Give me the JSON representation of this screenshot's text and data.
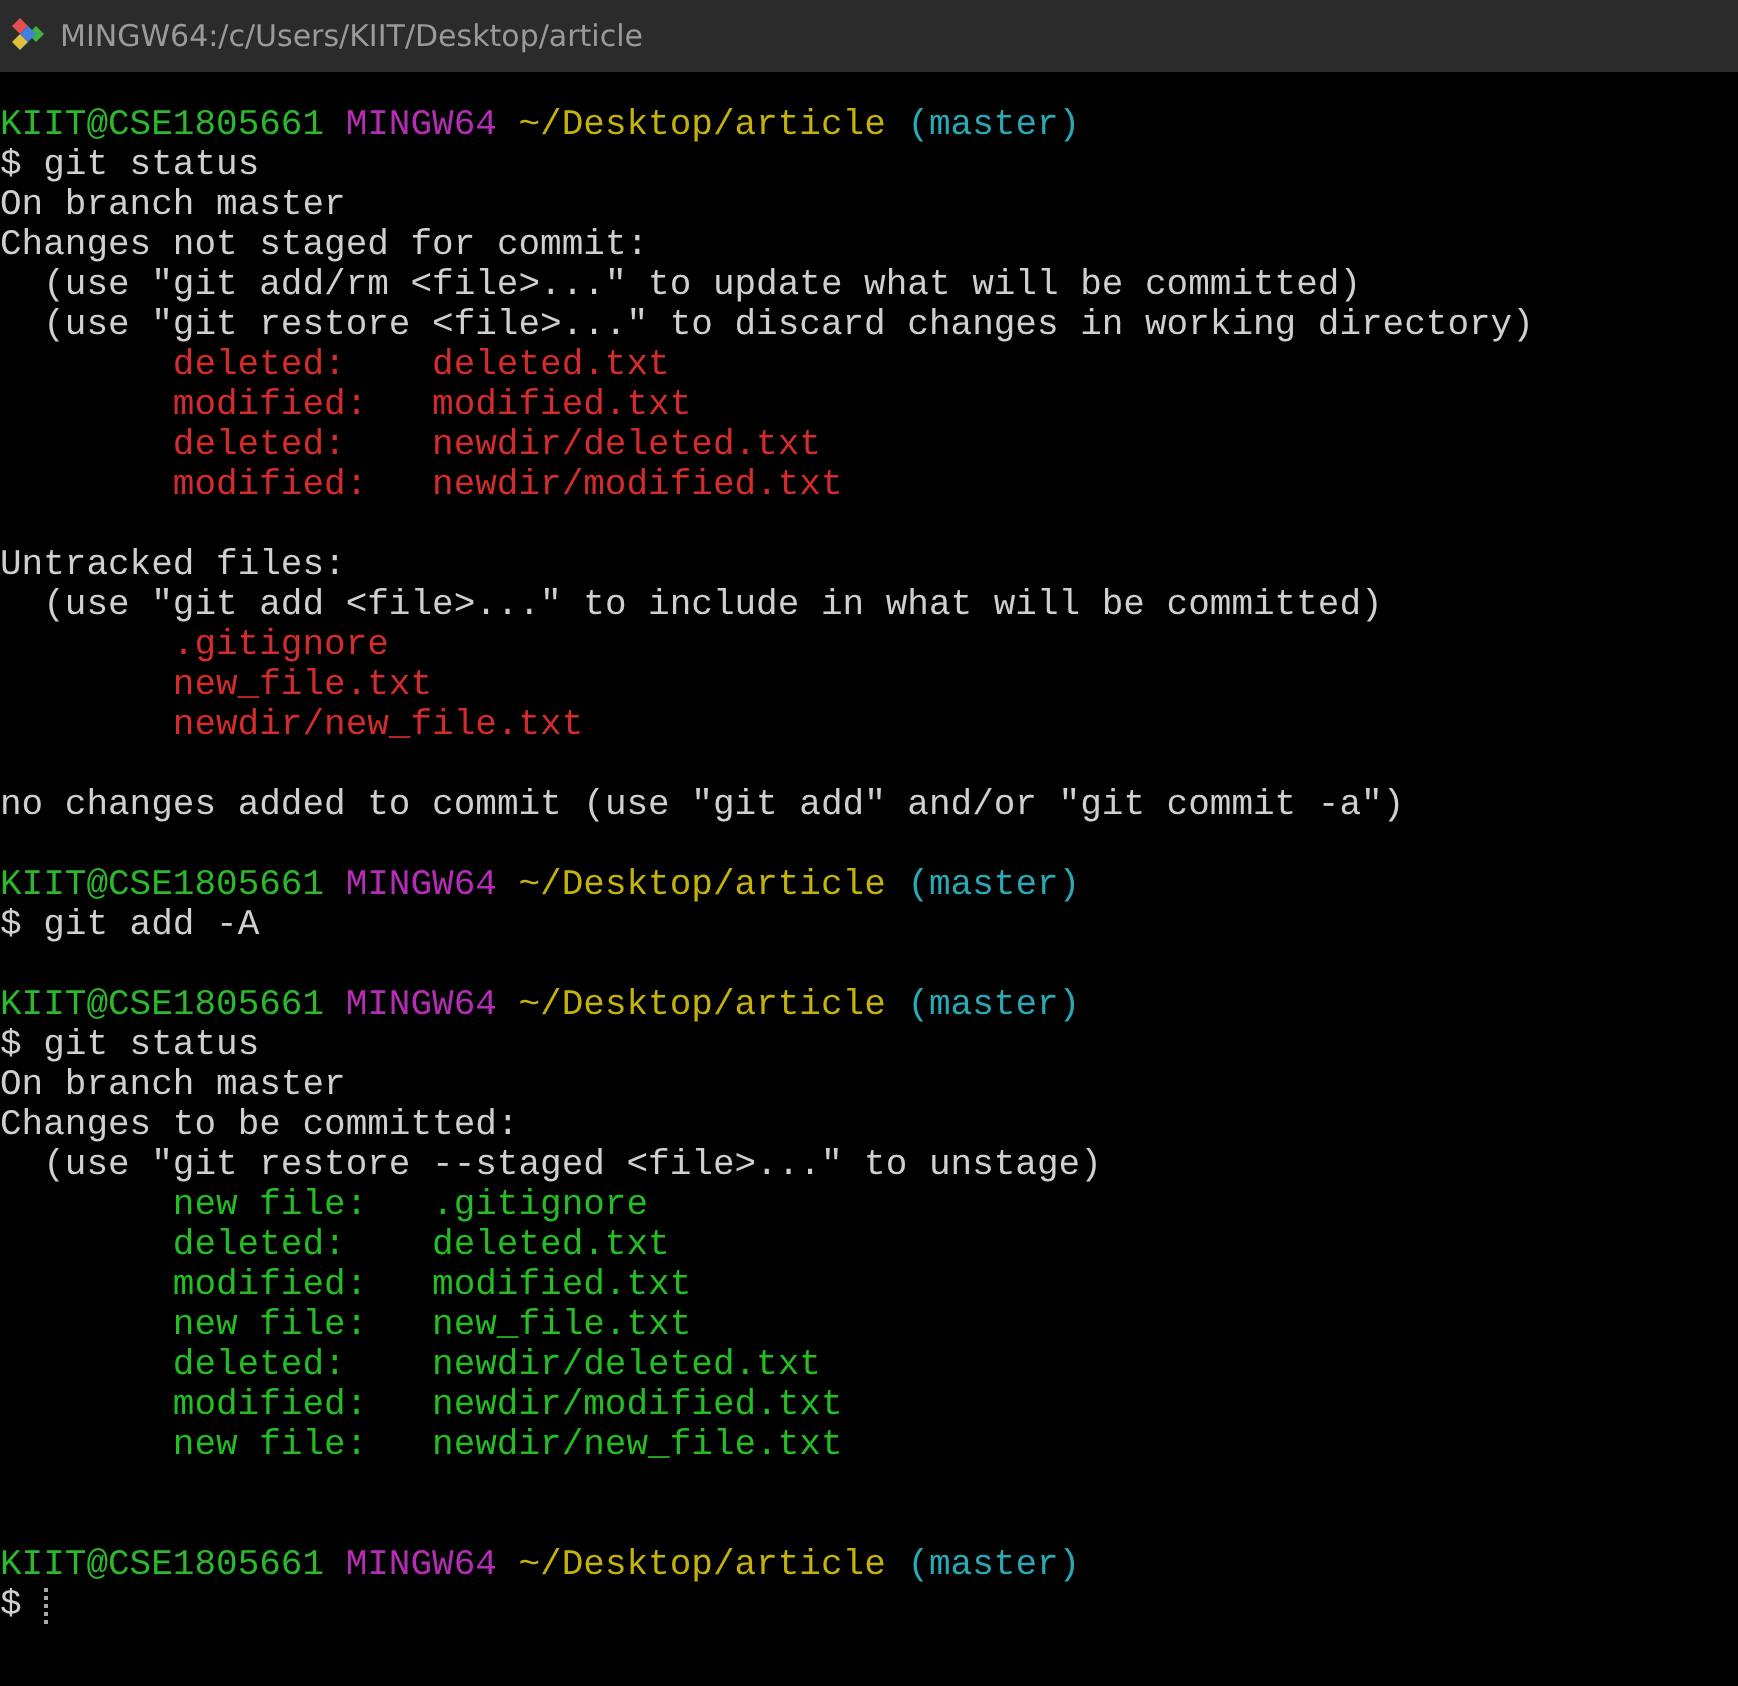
{
  "window": {
    "title": "MINGW64:/c/Users/KIIT/Desktop/article"
  },
  "lines": [
    {
      "kind": "prompt",
      "user": "KIIT@CSE1805661",
      "system": "MINGW64",
      "path": "~/Desktop/article",
      "branch": "(master)"
    },
    {
      "kind": "text",
      "text": "$ git status"
    },
    {
      "kind": "text",
      "text": "On branch master"
    },
    {
      "kind": "text",
      "text": "Changes not staged for commit:"
    },
    {
      "kind": "hint",
      "text": "(use \"git add/rm <file>...\" to update what will be committed)"
    },
    {
      "kind": "hint",
      "text": "(use \"git restore <file>...\" to discard changes in working directory)"
    },
    {
      "kind": "entry",
      "color": "#d42c2c",
      "status": "deleted:",
      "file": "deleted.txt"
    },
    {
      "kind": "entry",
      "color": "#d42c2c",
      "status": "modified:",
      "file": "modified.txt"
    },
    {
      "kind": "entry",
      "color": "#d42c2c",
      "status": "deleted:",
      "file": "newdir/deleted.txt"
    },
    {
      "kind": "entry",
      "color": "#d42c2c",
      "status": "modified:",
      "file": "newdir/modified.txt"
    },
    {
      "kind": "blank"
    },
    {
      "kind": "text",
      "text": "Untracked files:"
    },
    {
      "kind": "hint",
      "text": "(use \"git add <file>...\" to include in what will be committed)"
    },
    {
      "kind": "file",
      "color": "#d42c2c",
      "file": ".gitignore"
    },
    {
      "kind": "file",
      "color": "#d42c2c",
      "file": "new_file.txt"
    },
    {
      "kind": "file",
      "color": "#d42c2c",
      "file": "newdir/new_file.txt"
    },
    {
      "kind": "blank"
    },
    {
      "kind": "text",
      "text": "no changes added to commit (use \"git add\" and/or \"git commit -a\")"
    },
    {
      "kind": "blank"
    },
    {
      "kind": "prompt",
      "user": "KIIT@CSE1805661",
      "system": "MINGW64",
      "path": "~/Desktop/article",
      "branch": "(master)"
    },
    {
      "kind": "text",
      "text": "$ git add -A"
    },
    {
      "kind": "blank"
    },
    {
      "kind": "prompt",
      "user": "KIIT@CSE1805661",
      "system": "MINGW64",
      "path": "~/Desktop/article",
      "branch": "(master)"
    },
    {
      "kind": "text",
      "text": "$ git status"
    },
    {
      "kind": "text",
      "text": "On branch master"
    },
    {
      "kind": "text",
      "text": "Changes to be committed:"
    },
    {
      "kind": "hint",
      "text": "(use \"git restore --staged <file>...\" to unstage)"
    },
    {
      "kind": "entry",
      "color": "#25bc24",
      "status": "new file:",
      "file": ".gitignore"
    },
    {
      "kind": "entry",
      "color": "#25bc24",
      "status": "deleted:",
      "file": "deleted.txt"
    },
    {
      "kind": "entry",
      "color": "#25bc24",
      "status": "modified:",
      "file": "modified.txt"
    },
    {
      "kind": "entry",
      "color": "#25bc24",
      "status": "new file:",
      "file": "new_file.txt"
    },
    {
      "kind": "entry",
      "color": "#25bc24",
      "status": "deleted:",
      "file": "newdir/deleted.txt"
    },
    {
      "kind": "entry",
      "color": "#25bc24",
      "status": "modified:",
      "file": "newdir/modified.txt"
    },
    {
      "kind": "entry",
      "color": "#25bc24",
      "status": "new file:",
      "file": "newdir/new_file.txt"
    },
    {
      "kind": "blank"
    },
    {
      "kind": "blank"
    },
    {
      "kind": "prompt",
      "user": "KIIT@CSE1805661",
      "system": "MINGW64",
      "path": "~/Desktop/article",
      "branch": "(master)"
    },
    {
      "kind": "input",
      "text": "$"
    }
  ]
}
